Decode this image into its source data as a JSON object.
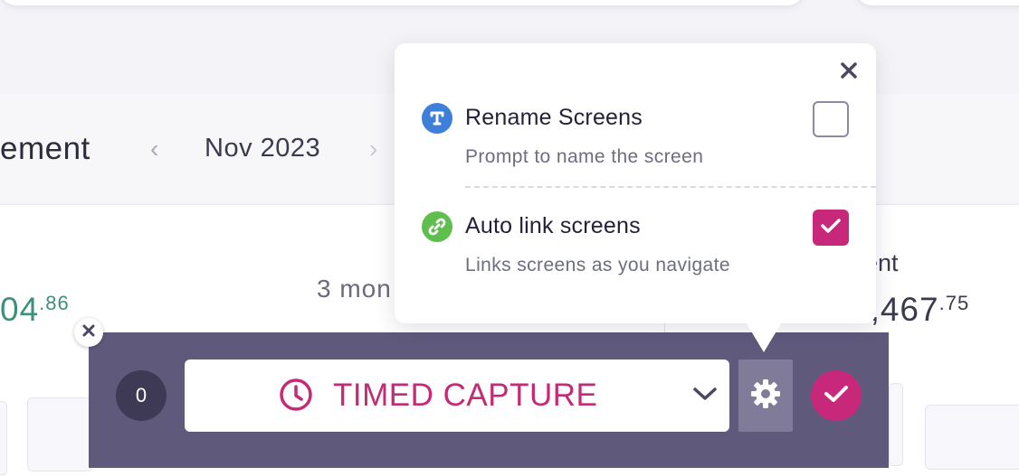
{
  "background": {
    "page_title": "ement",
    "month": "Nov 2023",
    "nav_prev": "‹",
    "nav_next": "›",
    "stat_left_main": "04",
    "stat_left_cents": ".86",
    "stat_mid": "3 mon",
    "stat_right_label": "ent",
    "stat_right_main": "3,467",
    "stat_right_cents": ".75"
  },
  "toolbar": {
    "counter": "0",
    "mode_label": "TIMED CAPTURE",
    "mode_icon": "clock-icon",
    "settings_icon": "gear-icon",
    "confirm_icon": "check-icon",
    "close_icon": "close-icon"
  },
  "popover": {
    "close_icon": "close-icon",
    "options": [
      {
        "title": "Rename Screens",
        "description": "Prompt to name the screen",
        "icon": "text-icon",
        "checked": false
      },
      {
        "title": "Auto link screens",
        "description": "Links screens as you navigate",
        "icon": "link-icon",
        "checked": true
      }
    ]
  },
  "colors": {
    "accent": "#c8287a",
    "toolbar_bg": "#5f5a7c",
    "rename_icon_bg": "#3d7fd9",
    "link_icon_bg": "#5ebe4e",
    "positive_value": "#3f8f7c"
  }
}
